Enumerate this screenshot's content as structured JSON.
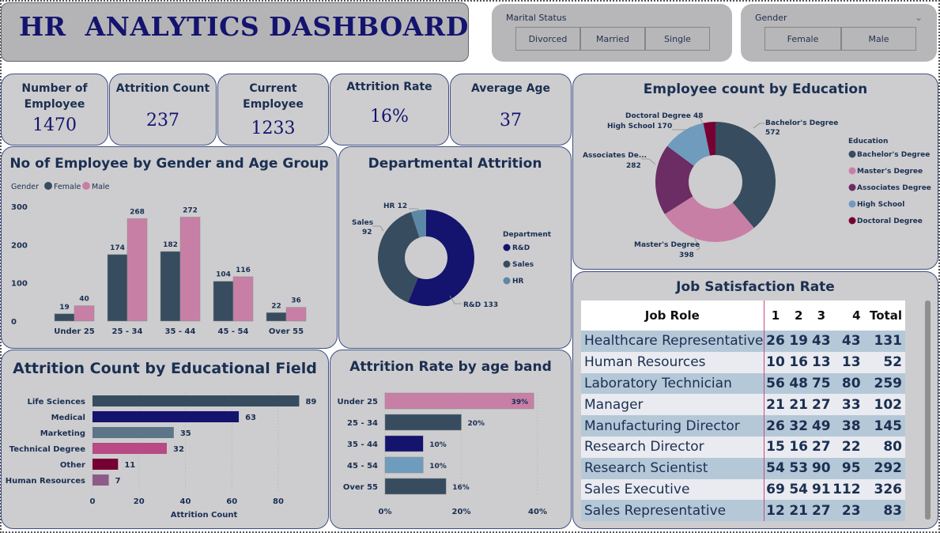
{
  "title": "HR  ANALYTICS DASHBOARD",
  "filters": {
    "marital": {
      "title": "Marital Status",
      "options": [
        "Divorced",
        "Married",
        "Single"
      ]
    },
    "gender": {
      "title": "Gender",
      "options": [
        "Female",
        "Male"
      ]
    }
  },
  "kpis": [
    {
      "label": "Number of Employee",
      "value": "1470"
    },
    {
      "label": "Attrition Count",
      "value": "237"
    },
    {
      "label": "Current Employee",
      "value": "1233"
    },
    {
      "label": "Attrition Rate",
      "value": "16%"
    },
    {
      "label": "Average Age",
      "value": "37"
    }
  ],
  "colors": {
    "navy": "#14136e",
    "slate": "#374c5e",
    "pink": "#c87fa6",
    "plum": "#6b2d63",
    "lightblue": "#6f9cbd",
    "maroon": "#770033",
    "steel": "#5c7588",
    "magenta": "#b84a85",
    "mauve": "#8e5b88",
    "text": "#1b2f52"
  },
  "chart_data": [
    {
      "type": "bar",
      "title": "No of Employee by Gender and Age Group",
      "legend_title": "Gender",
      "legend_position": "top-left",
      "categories": [
        "Under 25",
        "25 - 34",
        "35 - 44",
        "45 - 54",
        "Over 55"
      ],
      "series": [
        {
          "name": "Female",
          "values": [
            19,
            174,
            182,
            104,
            22
          ],
          "color": "#374c5e"
        },
        {
          "name": "Male",
          "values": [
            40,
            268,
            272,
            116,
            36
          ],
          "color": "#c87fa6"
        }
      ],
      "yticks": [
        "0",
        "100",
        "200",
        "300"
      ],
      "ylim": [
        0,
        300
      ]
    },
    {
      "type": "pie",
      "title": "Departmental Attrition",
      "legend_title": "Department",
      "legend_position": "right",
      "slices": [
        {
          "name": "R&D",
          "value": 133,
          "color": "#14136e",
          "label": "R&D 133"
        },
        {
          "name": "Sales",
          "value": 92,
          "color": "#374c5e",
          "label": "Sales 92"
        },
        {
          "name": "HR",
          "value": 12,
          "color": "#5d87a6",
          "label": "HR 12"
        }
      ]
    },
    {
      "type": "pie",
      "title": "Employee count by Education",
      "legend_title": "Education",
      "legend_position": "right",
      "slices": [
        {
          "name": "Bachelor's Degree",
          "value": 572,
          "color": "#374c5e",
          "label": "Bachelor's Degree 572"
        },
        {
          "name": "Master's Degree",
          "value": 398,
          "color": "#c87fa6",
          "label": "Master's Degree 398"
        },
        {
          "name": "Associates Degree",
          "value": 282,
          "color": "#6b2d63",
          "label": "Associates De... 282"
        },
        {
          "name": "High School",
          "value": 170,
          "color": "#6f9cbd",
          "label": "High School 170"
        },
        {
          "name": "Doctoral Degree",
          "value": 48,
          "color": "#770033",
          "label": "Doctoral Degree 48"
        }
      ]
    },
    {
      "type": "bar",
      "orientation": "horizontal",
      "title": "Attrition Count by Educational Field",
      "xlabel": "Attrition Count",
      "categories": [
        "Life Sciences",
        "Medical",
        "Marketing",
        "Technical Degree",
        "Other",
        "Human Resources"
      ],
      "values": [
        89,
        63,
        35,
        32,
        11,
        7
      ],
      "colors": [
        "#374c5e",
        "#14136e",
        "#5c7588",
        "#b84a85",
        "#770033",
        "#8e5b88"
      ],
      "xticks": [
        "0",
        "20",
        "40",
        "60",
        "80"
      ],
      "xlim": [
        0,
        95
      ]
    },
    {
      "type": "bar",
      "orientation": "horizontal",
      "title": "Attrition Rate by age band",
      "categories": [
        "Under 25",
        "25 - 34",
        "35 - 44",
        "45 - 54",
        "Over 55"
      ],
      "values": [
        39,
        20,
        10,
        10,
        16
      ],
      "labels": [
        "39%",
        "20%",
        "10%",
        "10%",
        "16%"
      ],
      "colors": [
        "#c87fa6",
        "#374c5e",
        "#14136e",
        "#6f9cbd",
        "#374c5e"
      ],
      "xticks": [
        "0%",
        "20%",
        "40%"
      ],
      "xlim": [
        0,
        40
      ]
    },
    {
      "type": "table",
      "title": "Job Satisfaction Rate",
      "columns": [
        "Job Role",
        "1",
        "2",
        "3",
        "4",
        "Total"
      ],
      "rows": [
        [
          "Healthcare Representative",
          "26",
          "19",
          "43",
          "43",
          "131"
        ],
        [
          "Human Resources",
          "10",
          "16",
          "13",
          "13",
          "52"
        ],
        [
          "Laboratory Technician",
          "56",
          "48",
          "75",
          "80",
          "259"
        ],
        [
          "Manager",
          "21",
          "21",
          "27",
          "33",
          "102"
        ],
        [
          "Manufacturing Director",
          "26",
          "32",
          "49",
          "38",
          "145"
        ],
        [
          "Research Director",
          "15",
          "16",
          "27",
          "22",
          "80"
        ],
        [
          "Research Scientist",
          "54",
          "53",
          "90",
          "95",
          "292"
        ],
        [
          "Sales Executive",
          "69",
          "54",
          "91",
          "112",
          "326"
        ],
        [
          "Sales Representative",
          "12",
          "21",
          "27",
          "23",
          "83"
        ]
      ]
    }
  ]
}
